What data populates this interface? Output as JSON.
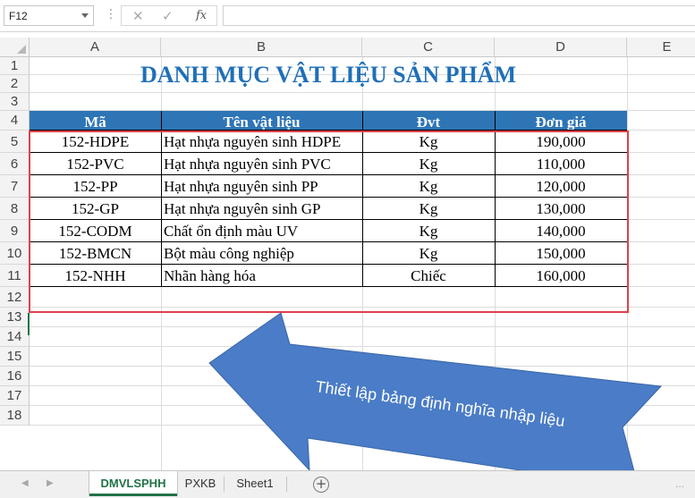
{
  "formula_bar": {
    "name_box": "F12",
    "cancel_icon": "✕",
    "enter_icon": "✓",
    "fx_label": "fx",
    "dots": "⋮",
    "formula": ""
  },
  "columns": [
    "A",
    "B",
    "C",
    "D",
    "E"
  ],
  "rows": [
    "1",
    "2",
    "3",
    "4",
    "5",
    "6",
    "7",
    "8",
    "9",
    "10",
    "11",
    "12",
    "13",
    "14",
    "15",
    "16",
    "17",
    "18"
  ],
  "title": "DANH MỤC VẬT LIỆU SẢN PHẨM",
  "table": {
    "headers": [
      "Mã",
      "Tên vật liệu",
      "Đvt",
      "Đơn giá"
    ],
    "rows": [
      [
        "152-HDPE",
        "Hạt nhựa nguyên sinh HDPE",
        "Kg",
        "190,000"
      ],
      [
        "152-PVC",
        "Hạt nhựa nguyên sinh PVC",
        "Kg",
        "110,000"
      ],
      [
        "152-PP",
        "Hạt nhựa nguyên sinh PP",
        "Kg",
        "120,000"
      ],
      [
        "152-GP",
        "Hạt nhựa nguyên sinh GP",
        "Kg",
        "130,000"
      ],
      [
        "152-CODM",
        "Chất ổn định màu UV",
        "Kg",
        "140,000"
      ],
      [
        "152-BMCN",
        "Bột màu công nghiệp",
        "Kg",
        "150,000"
      ],
      [
        "152-NHH",
        "Nhãn hàng hóa",
        "Chiếc",
        "160,000"
      ]
    ]
  },
  "callout": {
    "text": "Thiết lập bảng định nghĩa nhập liệu"
  },
  "sheets": {
    "tabs": [
      "DMVLSPHH",
      "PXKB",
      "Sheet1"
    ],
    "active": "DMVLSPHH",
    "add_icon": "+",
    "nav_prev": "◀",
    "nav_next": "▶",
    "more": "..."
  },
  "colors": {
    "title": "#1f6fb8",
    "header_fill": "#2e75b6",
    "frame": "#e0404a",
    "arrow": "#4a7cc7",
    "excel_green": "#217346"
  }
}
